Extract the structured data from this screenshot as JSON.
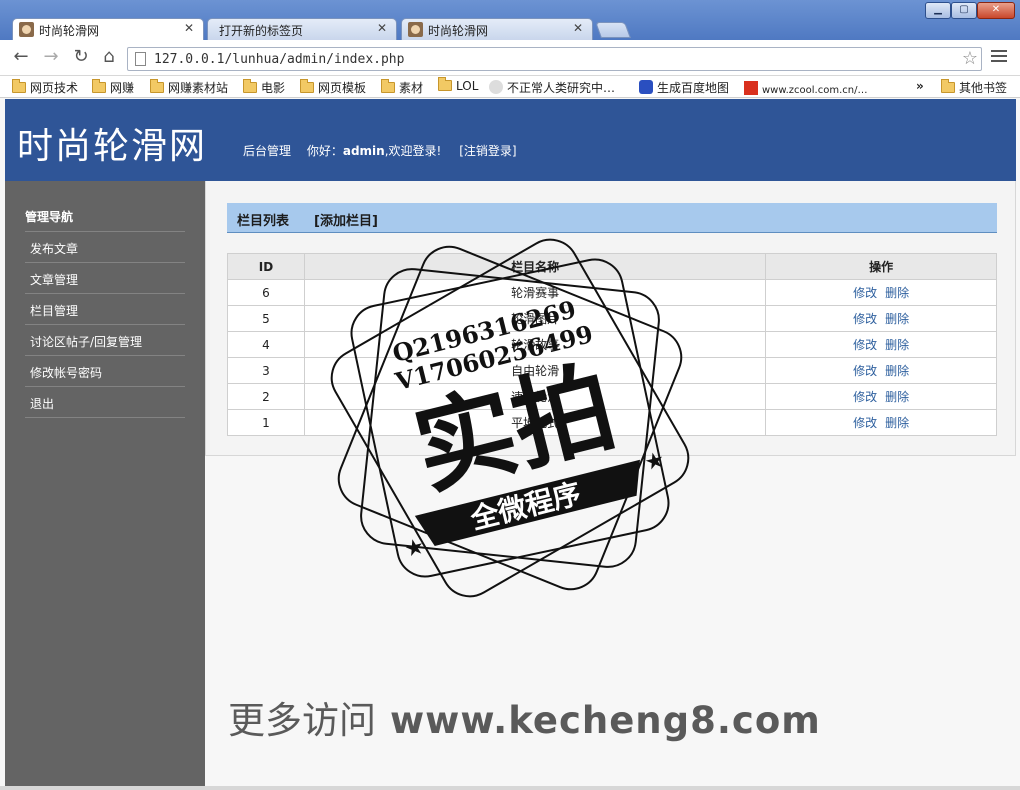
{
  "browser": {
    "tabs": [
      {
        "title": "时尚轮滑网",
        "active": true
      },
      {
        "title": "打开新的标签页",
        "active": false
      },
      {
        "title": "时尚轮滑网",
        "active": false
      }
    ],
    "address": "127.0.0.1/lunhua/admin/index.php",
    "bookmarks": [
      "网页技术",
      "网赚",
      "网赚素材站",
      "电影",
      "网页模板",
      "素材",
      "LOL",
      "不正常人类研究中…",
      "生成百度地图",
      "www.zcool.com.cn/…"
    ],
    "overflow": "»",
    "other_bookmarks": "其他书签"
  },
  "header": {
    "site_title": "时尚轮滑网",
    "admin_label": "后台管理",
    "greeting_prefix": "你好：",
    "username": "admin",
    "greeting_suffix": ",欢迎登录!",
    "logout": "[注销登录]"
  },
  "sidebar": {
    "title": "管理导航",
    "items": [
      "发布文章",
      "文章管理",
      "栏目管理",
      "讨论区帖子/回复管理",
      "修改帐号密码",
      "退出"
    ]
  },
  "main": {
    "list_title": "栏目列表",
    "add_link": "[添加栏目]",
    "columns": [
      "ID",
      "栏目名称",
      "操作"
    ],
    "rows": [
      {
        "id": "6",
        "name": "轮滑赛事"
      },
      {
        "id": "5",
        "name": "轮滑图片"
      },
      {
        "id": "4",
        "name": "轮滑故事"
      },
      {
        "id": "3",
        "name": "自由轮滑"
      },
      {
        "id": "2",
        "name": "速度轮滑"
      },
      {
        "id": "1",
        "name": "平地花式"
      }
    ],
    "edit_label": "修改",
    "delete_label": "删除"
  },
  "overlay": {
    "stamp_line1": "Q2196316269",
    "stamp_line2": "V17060256499",
    "stamp_big": "实拍",
    "stamp_banner": "全微程序",
    "watermark_cn": "更多访问",
    "watermark_url": "www.kecheng8.com"
  },
  "colors": {
    "header_bg": "#2f5597",
    "sidebar_bg": "#646464",
    "list_bar": "#a7c9ed",
    "link": "#2d5f9e"
  }
}
